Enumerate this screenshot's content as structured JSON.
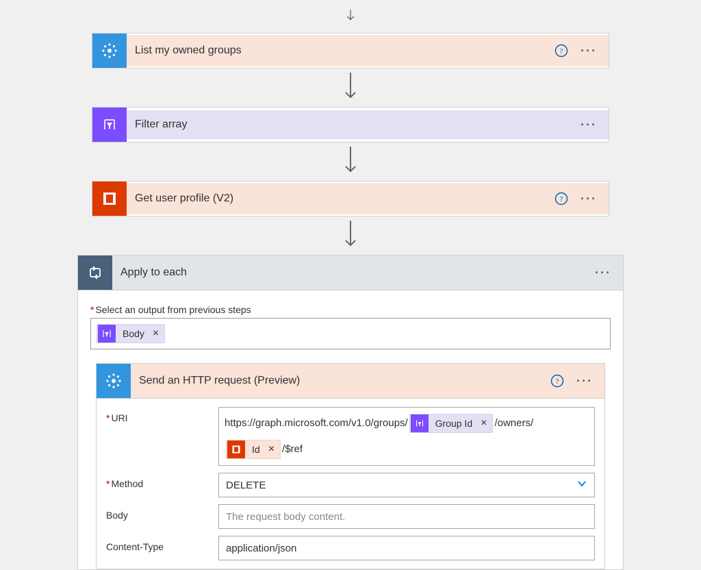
{
  "steps": {
    "list_groups": {
      "label": "List my owned groups"
    },
    "filter_array": {
      "label": "Filter array"
    },
    "get_user_profile": {
      "label": "Get user profile (V2)"
    },
    "apply_to_each": {
      "label": "Apply to each"
    },
    "send_http": {
      "label": "Send an HTTP request",
      "preview": "(Preview)"
    }
  },
  "apply_each": {
    "prompt_label": "Select an output from previous steps",
    "token": {
      "label": "Body"
    }
  },
  "http_form": {
    "uri_label": "URI",
    "uri_part1": "https://graph.microsoft.com/v1.0/groups/",
    "uri_token1": "Group Id",
    "uri_part2": "/owners/",
    "uri_token2": "Id",
    "uri_part3": "/$ref",
    "method_label": "Method",
    "method_value": "DELETE",
    "body_label": "Body",
    "body_placeholder": "The request body content.",
    "content_type_label": "Content-Type",
    "content_type_value": "application/json"
  }
}
